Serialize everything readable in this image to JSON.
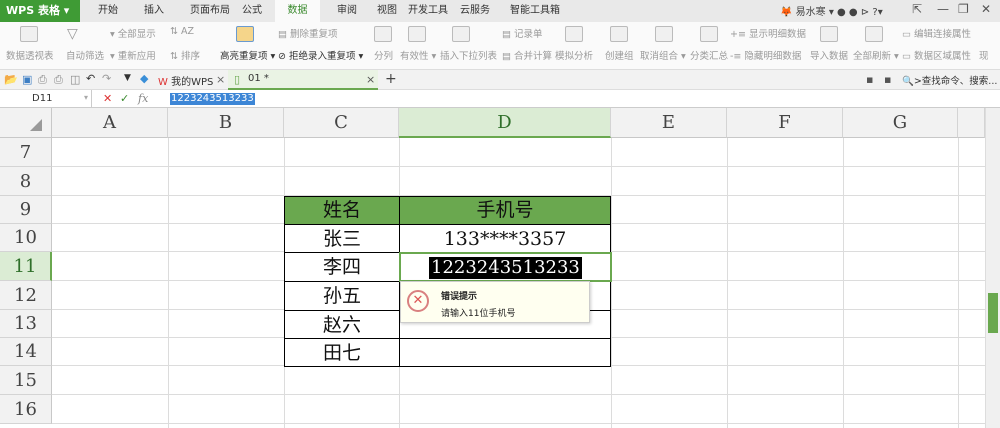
{
  "app": {
    "name": "WPS 表格",
    "user": "易水寒"
  },
  "tabs": [
    "开始",
    "插入",
    "页面布局",
    "公式",
    "数据",
    "审阅",
    "视图",
    "开发工具",
    "云服务",
    "智能工具箱"
  ],
  "active_tab": "数据",
  "ribbon": {
    "pivot": "数据透视表",
    "autofilter": "自动筛选",
    "show_all": "全部显示",
    "reapply": "重新应用",
    "sort": "排序",
    "highlight_dup": "高亮重复项",
    "delete_dup": "删除重复项",
    "reject_dup": "拒绝录入重复项",
    "split": "分列",
    "validity": "有效性",
    "dropdown": "插入下拉列表",
    "record": "记录单",
    "consolidate": "合并计算",
    "whatif": "模拟分析",
    "group": "创建组",
    "ungroup": "取消组合",
    "subtotal": "分类汇总",
    "show_detail": "显示明细数据",
    "hide_detail": "隐藏明细数据",
    "import": "导入数据",
    "refresh_all": "全部刷新",
    "edit_link": "编辑连接属性",
    "range_prop": "数据区域属性",
    "more": "现"
  },
  "doc_tabs": {
    "mywps": "我的WPS",
    "file": "01 *"
  },
  "search": ">查找命令、搜索...",
  "formula_bar": {
    "name_box": "D11",
    "fx": "fx",
    "value": "1223243513233"
  },
  "columns": [
    "A",
    "B",
    "C",
    "D",
    "E",
    "F",
    "G"
  ],
  "rows": [
    "7",
    "8",
    "9",
    "10",
    "11",
    "12",
    "13",
    "14",
    "15",
    "16"
  ],
  "table": {
    "headers": [
      "姓名",
      "手机号"
    ],
    "names": [
      "张三",
      "李四",
      "孙五",
      "赵六",
      "田七"
    ],
    "phones": [
      "133****3357",
      "1223243513233",
      "",
      "",
      ""
    ]
  },
  "error_tip": {
    "title": "错误提示",
    "message": "请输入11位手机号"
  }
}
